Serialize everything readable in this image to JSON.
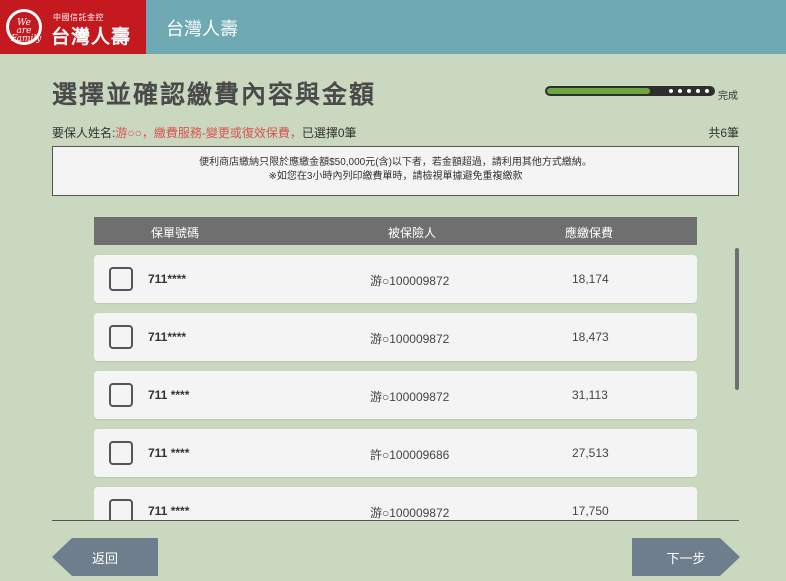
{
  "header": {
    "logo_small": "中國信託金控",
    "logo_big": "台灣人壽",
    "logo_emblem_text": "We are Family",
    "title": "台灣人壽"
  },
  "page": {
    "title": "選擇並確認繳費內容與金額",
    "progress_label": "完成",
    "progress_fraction": 0.62
  },
  "info": {
    "prefix": "要保人姓名:",
    "name": "游○○",
    "service": "，繳費服務-變更或復效保費，",
    "selected": "已選擇0筆",
    "total": "共6筆"
  },
  "notice": {
    "line1": "便利商店繳納只限於應繳金額$50,000元(含)以下者，若金額超過，請利用其他方式繳納。",
    "line2": "※如您在3小時內列印繳費單時，請檢視單據避免重複繳款"
  },
  "table": {
    "columns": [
      "保單號碼",
      "被保險人",
      "應繳保費"
    ],
    "rows": [
      {
        "policy": "711****",
        "insured": "游○100009872",
        "premium": "18,174"
      },
      {
        "policy": "711****",
        "insured": "游○100009872",
        "premium": "18,473"
      },
      {
        "policy": "711 ****",
        "insured": "游○100009872",
        "premium": "31,113"
      },
      {
        "policy": "711 ****",
        "insured": "許○100009686",
        "premium": "27,513"
      },
      {
        "policy": "711 ****",
        "insured": "游○100009872",
        "premium": "17,750"
      }
    ]
  },
  "buttons": {
    "back": "返回",
    "next": "下一步"
  }
}
